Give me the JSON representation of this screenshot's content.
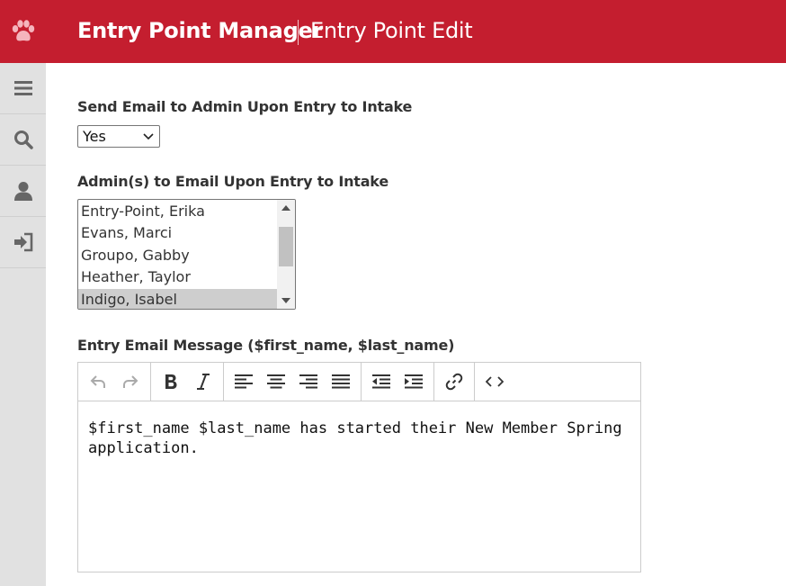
{
  "header": {
    "app_title": "Entry Point Manager",
    "page_title": "Entry Point Edit",
    "brand_color": "#c41e2f"
  },
  "sidebar": {
    "items": [
      {
        "icon": "menu-icon"
      },
      {
        "icon": "search-icon"
      },
      {
        "icon": "user-icon"
      },
      {
        "icon": "logout-icon"
      }
    ]
  },
  "form": {
    "send_email_label": "Send Email to Admin Upon Entry to Intake",
    "send_email_value": "Yes",
    "admins_label": "Admin(s) to Email Upon Entry to Intake",
    "admins_options": [
      {
        "name": "Entry-Point, Erika",
        "selected": false
      },
      {
        "name": "Evans, Marci",
        "selected": false
      },
      {
        "name": "Groupo, Gabby",
        "selected": false
      },
      {
        "name": "Heather, Taylor",
        "selected": false
      },
      {
        "name": "Indigo, Isabel",
        "selected": true
      }
    ],
    "message_label": "Entry Email Message ($first_name, $last_name)",
    "message_line1": "$first_name $last_name has started their New Member Spring",
    "message_line2": "application."
  },
  "editor_toolbar": {
    "groups": [
      [
        "undo-icon",
        "redo-icon"
      ],
      [
        "bold-icon",
        "italic-icon"
      ],
      [
        "align-left-icon",
        "align-center-icon",
        "align-right-icon",
        "align-justify-icon"
      ],
      [
        "outdent-icon",
        "indent-icon"
      ],
      [
        "link-icon"
      ],
      [
        "code-icon"
      ]
    ]
  }
}
